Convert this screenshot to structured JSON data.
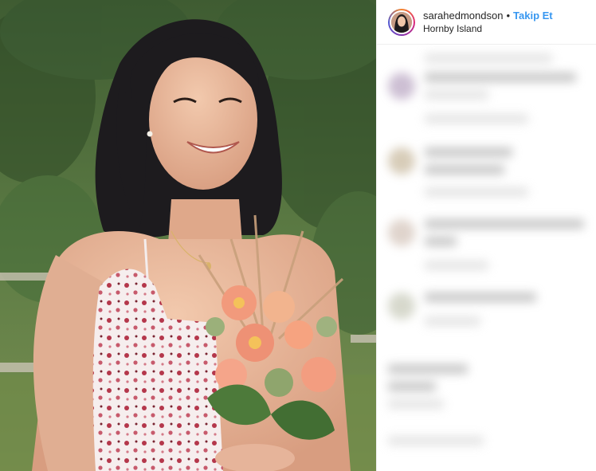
{
  "post": {
    "header": {
      "username": "sarahedmondson",
      "separator": "•",
      "follow_label": "Takip Et",
      "location": "Hornby Island"
    },
    "photo": {
      "subject": "smiling-woman-with-flower-bouquet"
    },
    "comments_blurred": true,
    "colors": {
      "follow": "#3897f0",
      "text": "#262626",
      "border": "#efefef"
    }
  }
}
